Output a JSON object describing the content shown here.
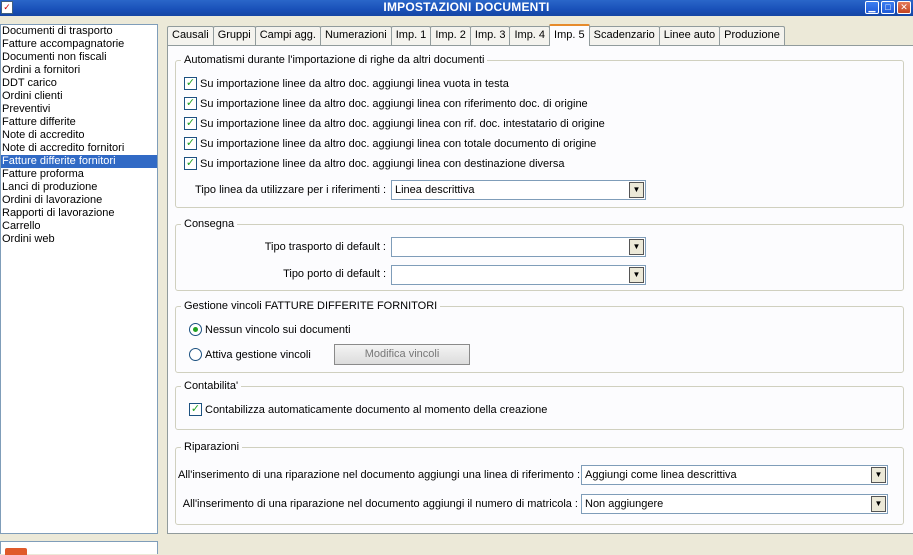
{
  "window": {
    "title": "IMPOSTAZIONI DOCUMENTI",
    "minimize": "▁",
    "maximize": "□",
    "close": "✕"
  },
  "doc_types": [
    "Documenti di trasporto",
    "Fatture accompagnatorie",
    "Documenti non fiscali",
    "Ordini a fornitori",
    "DDT carico",
    "Ordini clienti",
    "Preventivi",
    "Fatture differite",
    "Note di accredito",
    "Note di accredito fornitori",
    "Fatture differite fornitori",
    "Fatture proforma",
    "Lanci di produzione",
    "Ordini di lavorazione",
    "Rapporti di lavorazione",
    "Carrello",
    "Ordini web"
  ],
  "selected_doc_type": "Fatture differite fornitori",
  "tabs": [
    "Causali",
    "Gruppi",
    "Campi agg.",
    "Numerazioni",
    "Imp. 1",
    "Imp. 2",
    "Imp. 3",
    "Imp. 4",
    "Imp. 5",
    "Scadenzario",
    "Linee auto",
    "Produzione"
  ],
  "active_tab": "Imp. 5",
  "automatismi": {
    "legend": "Automatismi durante l'importazione di righe da altri documenti",
    "checks": [
      {
        "label": "Su importazione linee da altro doc. aggiungi linea vuota in testa",
        "checked": true
      },
      {
        "label": "Su importazione linee da altro doc. aggiungi linea con riferimento doc. di origine",
        "checked": true
      },
      {
        "label": "Su importazione linee da altro doc. aggiungi linea con rif. doc. intestatario di origine",
        "checked": true
      },
      {
        "label": "Su importazione linee da altro doc. aggiungi linea con totale documento di origine",
        "checked": true
      },
      {
        "label": "Su importazione linee da altro doc. aggiungi linea con destinazione diversa",
        "checked": true
      }
    ],
    "tipo_linea_label": "Tipo linea da utilizzare per i riferimenti :",
    "tipo_linea_value": "Linea descrittiva"
  },
  "consegna": {
    "legend": "Consegna",
    "trasporto_label": "Tipo trasporto di default :",
    "trasporto_value": "",
    "porto_label": "Tipo porto di default :",
    "porto_value": ""
  },
  "vincoli": {
    "legend": "Gestione vincoli FATTURE DIFFERITE FORNITORI",
    "option_none": "Nessun vincolo sui documenti",
    "option_active": "Attiva gestione vincoli",
    "selected": "none",
    "modifica_button": "Modifica vincoli"
  },
  "contabilita": {
    "legend": "Contabilita'",
    "check_label": "Contabilizza automaticamente documento al momento della creazione",
    "checked": true
  },
  "riparazioni": {
    "legend": "Riparazioni",
    "linea_rif_label": "All'inserimento di una riparazione nel documento aggiungi una linea di riferimento :",
    "linea_rif_value": "Aggiungi come linea descrittiva",
    "matricola_label": "All'inserimento di una riparazione nel documento aggiungi il numero di matricola :",
    "matricola_value": "Non aggiungere"
  },
  "icons": {
    "checkmark": "✓",
    "dropdown": "▼"
  }
}
